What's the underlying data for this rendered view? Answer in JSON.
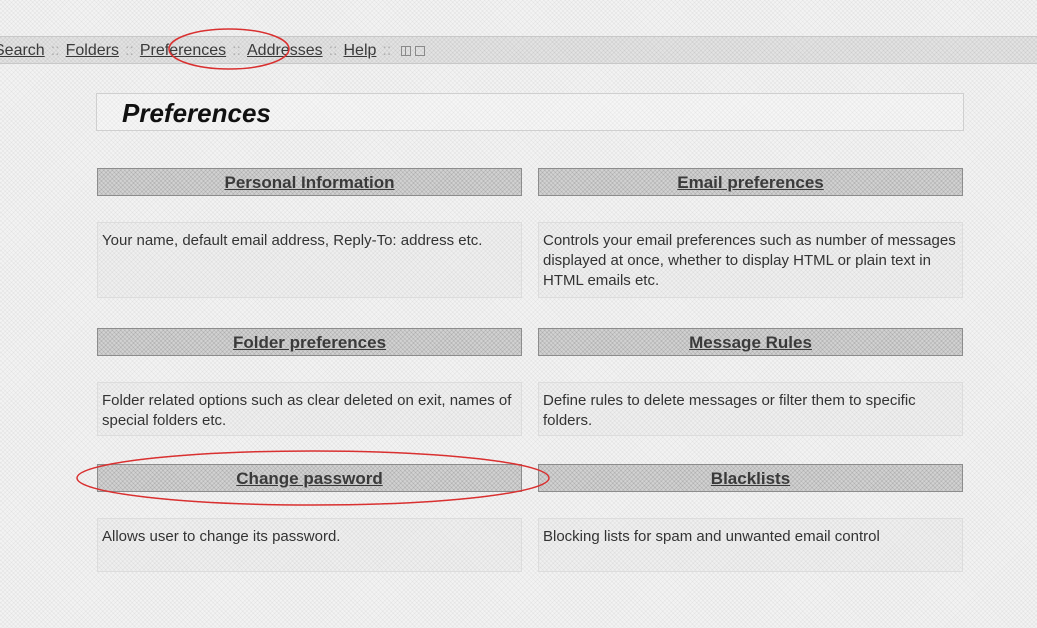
{
  "nav": {
    "items": [
      "Search",
      "Folders",
      "Preferences",
      "Addresses",
      "Help"
    ],
    "separator": "::"
  },
  "page": {
    "title": "Preferences"
  },
  "sections": [
    {
      "header": "Personal Information",
      "description": "Your name, default email address, Reply-To: address etc."
    },
    {
      "header": "Email preferences",
      "description": "Controls your email preferences such as number of messages displayed at once, whether to display HTML or plain text in HTML emails etc."
    },
    {
      "header": "Folder preferences",
      "description": "Folder related options such as clear deleted on exit, names of special folders etc."
    },
    {
      "header": "Message Rules",
      "description": "Define rules to delete messages or filter them to specific folders."
    },
    {
      "header": "Change password",
      "description": "Allows user to change its password."
    },
    {
      "header": "Blacklists",
      "description": "Blocking lists for spam and unwanted email control"
    }
  ],
  "annotations": {
    "highlight_color": "#d93030"
  }
}
